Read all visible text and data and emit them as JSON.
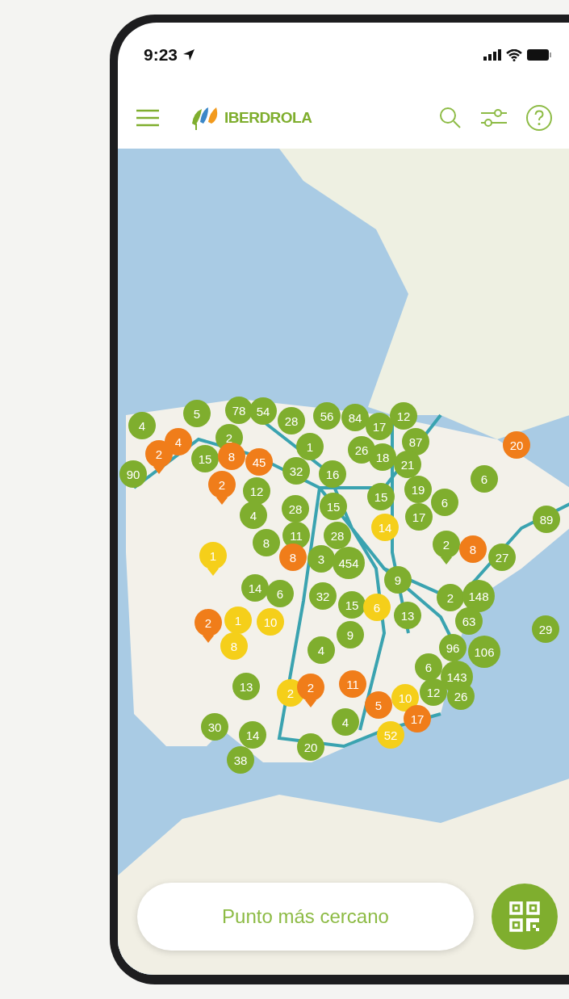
{
  "status_bar": {
    "time": "9:23"
  },
  "header": {
    "logo_text": "IBERDROLA"
  },
  "map": {
    "markers": [
      {
        "label": "5",
        "color": "#7fae2e",
        "kind": "cluster"
      },
      {
        "label": "78",
        "color": "#7fae2e",
        "kind": "cluster"
      },
      {
        "label": "54",
        "color": "#7fae2e",
        "kind": "cluster"
      },
      {
        "label": "28",
        "color": "#7fae2e",
        "kind": "cluster"
      },
      {
        "label": "56",
        "color": "#7fae2e",
        "kind": "cluster"
      },
      {
        "label": "84",
        "color": "#7fae2e",
        "kind": "cluster"
      },
      {
        "label": "12",
        "color": "#7fae2e",
        "kind": "cluster"
      },
      {
        "label": "4",
        "color": "#7fae2e",
        "kind": "cluster"
      },
      {
        "label": "17",
        "color": "#7fae2e",
        "kind": "cluster"
      },
      {
        "label": "4",
        "color": "#f07d1a",
        "kind": "cluster"
      },
      {
        "label": "2",
        "color": "#7fae2e",
        "kind": "cluster"
      },
      {
        "label": "1",
        "color": "#7fae2e",
        "kind": "cluster"
      },
      {
        "label": "26",
        "color": "#7fae2e",
        "kind": "cluster"
      },
      {
        "label": "87",
        "color": "#7fae2e",
        "kind": "cluster"
      },
      {
        "label": "20",
        "color": "#f07d1a",
        "kind": "cluster"
      },
      {
        "label": "2",
        "color": "#f07d1a",
        "kind": "pin"
      },
      {
        "label": "15",
        "color": "#7fae2e",
        "kind": "cluster"
      },
      {
        "label": "8",
        "color": "#f07d1a",
        "kind": "cluster"
      },
      {
        "label": "45",
        "color": "#f07d1a",
        "kind": "cluster"
      },
      {
        "label": "18",
        "color": "#7fae2e",
        "kind": "cluster"
      },
      {
        "label": "21",
        "color": "#7fae2e",
        "kind": "cluster"
      },
      {
        "label": "90",
        "color": "#7fae2e",
        "kind": "cluster"
      },
      {
        "label": "2",
        "color": "#f07d1a",
        "kind": "pin"
      },
      {
        "label": "32",
        "color": "#7fae2e",
        "kind": "cluster"
      },
      {
        "label": "16",
        "color": "#7fae2e",
        "kind": "cluster"
      },
      {
        "label": "6",
        "color": "#7fae2e",
        "kind": "cluster"
      },
      {
        "label": "12",
        "color": "#7fae2e",
        "kind": "cluster"
      },
      {
        "label": "19",
        "color": "#7fae2e",
        "kind": "cluster"
      },
      {
        "label": "15",
        "color": "#7fae2e",
        "kind": "cluster"
      },
      {
        "label": "28",
        "color": "#7fae2e",
        "kind": "cluster"
      },
      {
        "label": "15",
        "color": "#7fae2e",
        "kind": "cluster"
      },
      {
        "label": "6",
        "color": "#7fae2e",
        "kind": "cluster"
      },
      {
        "label": "4",
        "color": "#7fae2e",
        "kind": "cluster"
      },
      {
        "label": "17",
        "color": "#7fae2e",
        "kind": "cluster"
      },
      {
        "label": "89",
        "color": "#7fae2e",
        "kind": "cluster"
      },
      {
        "label": "14",
        "color": "#f5cf1a",
        "kind": "cluster"
      },
      {
        "label": "8",
        "color": "#7fae2e",
        "kind": "cluster"
      },
      {
        "label": "11",
        "color": "#7fae2e",
        "kind": "cluster"
      },
      {
        "label": "28",
        "color": "#7fae2e",
        "kind": "cluster"
      },
      {
        "label": "2",
        "color": "#7fae2e",
        "kind": "pin"
      },
      {
        "label": "8",
        "color": "#f07d1a",
        "kind": "cluster"
      },
      {
        "label": "1",
        "color": "#f5cf1a",
        "kind": "pin"
      },
      {
        "label": "8",
        "color": "#f07d1a",
        "kind": "cluster"
      },
      {
        "label": "3",
        "color": "#7fae2e",
        "kind": "cluster"
      },
      {
        "label": "454",
        "color": "#7fae2e",
        "kind": "cluster"
      },
      {
        "label": "27",
        "color": "#7fae2e",
        "kind": "cluster"
      },
      {
        "label": "9",
        "color": "#7fae2e",
        "kind": "cluster"
      },
      {
        "label": "14",
        "color": "#7fae2e",
        "kind": "cluster"
      },
      {
        "label": "6",
        "color": "#7fae2e",
        "kind": "cluster"
      },
      {
        "label": "32",
        "color": "#7fae2e",
        "kind": "cluster"
      },
      {
        "label": "2",
        "color": "#7fae2e",
        "kind": "cluster"
      },
      {
        "label": "148",
        "color": "#7fae2e",
        "kind": "cluster"
      },
      {
        "label": "15",
        "color": "#7fae2e",
        "kind": "cluster"
      },
      {
        "label": "6",
        "color": "#f5cf1a",
        "kind": "cluster"
      },
      {
        "label": "13",
        "color": "#7fae2e",
        "kind": "cluster"
      },
      {
        "label": "2",
        "color": "#f07d1a",
        "kind": "pin"
      },
      {
        "label": "1",
        "color": "#f5cf1a",
        "kind": "cluster"
      },
      {
        "label": "10",
        "color": "#f5cf1a",
        "kind": "cluster"
      },
      {
        "label": "63",
        "color": "#7fae2e",
        "kind": "cluster"
      },
      {
        "label": "29",
        "color": "#7fae2e",
        "kind": "cluster"
      },
      {
        "label": "9",
        "color": "#7fae2e",
        "kind": "cluster"
      },
      {
        "label": "8",
        "color": "#f5cf1a",
        "kind": "cluster"
      },
      {
        "label": "4",
        "color": "#7fae2e",
        "kind": "cluster"
      },
      {
        "label": "96",
        "color": "#7fae2e",
        "kind": "cluster"
      },
      {
        "label": "106",
        "color": "#7fae2e",
        "kind": "cluster"
      },
      {
        "label": "6",
        "color": "#7fae2e",
        "kind": "cluster"
      },
      {
        "label": "143",
        "color": "#7fae2e",
        "kind": "cluster"
      },
      {
        "label": "13",
        "color": "#7fae2e",
        "kind": "cluster"
      },
      {
        "label": "2",
        "color": "#f5cf1a",
        "kind": "cluster"
      },
      {
        "label": "2",
        "color": "#f07d1a",
        "kind": "pin"
      },
      {
        "label": "11",
        "color": "#f07d1a",
        "kind": "cluster"
      },
      {
        "label": "10",
        "color": "#f5cf1a",
        "kind": "cluster"
      },
      {
        "label": "12",
        "color": "#7fae2e",
        "kind": "cluster"
      },
      {
        "label": "26",
        "color": "#7fae2e",
        "kind": "cluster"
      },
      {
        "label": "5",
        "color": "#f07d1a",
        "kind": "cluster"
      },
      {
        "label": "17",
        "color": "#f07d1a",
        "kind": "cluster"
      },
      {
        "label": "4",
        "color": "#7fae2e",
        "kind": "cluster"
      },
      {
        "label": "30",
        "color": "#7fae2e",
        "kind": "cluster"
      },
      {
        "label": "14",
        "color": "#7fae2e",
        "kind": "cluster"
      },
      {
        "label": "52",
        "color": "#f5cf1a",
        "kind": "cluster"
      },
      {
        "label": "20",
        "color": "#7fae2e",
        "kind": "cluster"
      },
      {
        "label": "38",
        "color": "#7fae2e",
        "kind": "cluster"
      }
    ]
  },
  "nearest_button": {
    "label": "Punto más cercano"
  }
}
